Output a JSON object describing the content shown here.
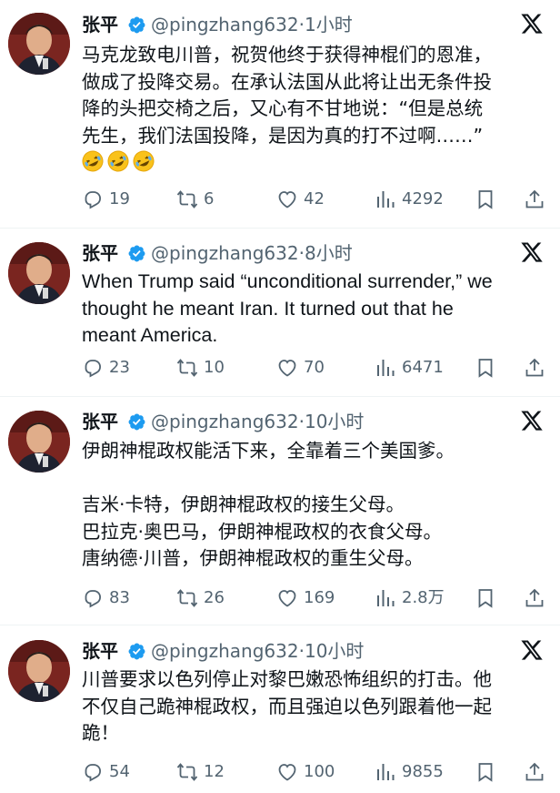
{
  "tweets": [
    {
      "author": "张平",
      "handle": "@pingzhang632",
      "time": "·1小时",
      "lines": [
        "马克龙致电川普，祝贺他终于获得神棍们的恩准，",
        "做成了投降交易。在承认法国从此将让出无条件投",
        "降的头把交椅之后，又心有不甘地说：“但是总统",
        "先生，我们法国投降，是因为真的打不过啊……”"
      ],
      "emoji": [
        "rofl-emoji",
        "rofl-emoji",
        "rofl-emoji"
      ],
      "stats": {
        "replies": "19",
        "retweets": "6",
        "likes": "42",
        "views": "4292"
      }
    },
    {
      "author": "张平",
      "handle": "@pingzhang632",
      "time": "·8小时",
      "lines": [
        "When Trump said “unconditional surrender,” we",
        "thought he meant Iran. It turned out that he",
        "meant America."
      ],
      "stats": {
        "replies": "23",
        "retweets": "10",
        "likes": "70",
        "views": "6471"
      }
    },
    {
      "author": "张平",
      "handle": "@pingzhang632",
      "time": "·10小时",
      "lines": [
        "伊朗神棍政权能活下来，全靠着三个美国爹。",
        "",
        "吉米·卡特，伊朗神棍政权的接生父母。",
        "巴拉克·奥巴马，伊朗神棍政权的衣食父母。",
        "唐纳德·川普，伊朗神棍政权的重生父母。"
      ],
      "stats": {
        "replies": "83",
        "retweets": "26",
        "likes": "169",
        "views": "2.8万"
      }
    },
    {
      "author": "张平",
      "handle": "@pingzhang632",
      "time": "·10小时",
      "lines": [
        "川普要求以色列停止对黎巴嫩恐怖组织的打击。他",
        "不仅自己跪神棍政权，而且强迫以色列跟着他一起",
        "跪！"
      ],
      "stats": {
        "replies": "54",
        "retweets": "12",
        "likes": "100",
        "views": "9855"
      }
    }
  ],
  "icons": {
    "verified": "verified-badge-icon",
    "platform": "x-logo-icon",
    "reply": "reply-icon",
    "retweet": "retweet-icon",
    "like": "heart-icon",
    "views": "views-icon",
    "bookmark": "bookmark-icon",
    "share": "share-icon"
  },
  "colors": {
    "text": "#0f1419",
    "secondary": "#536471",
    "verified": "#1d9bf0",
    "divider": "#eff3f4"
  }
}
